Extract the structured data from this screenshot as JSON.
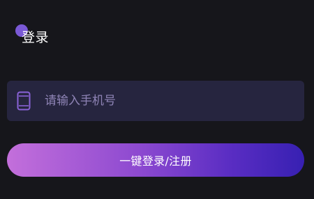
{
  "header": {
    "title": "登录"
  },
  "login_form": {
    "phone_placeholder": "请输入手机号",
    "phone_value": "",
    "submit_label": "一键登录/注册"
  },
  "icons": {
    "phone": "mobile-phone-icon"
  },
  "colors": {
    "background": "#16161b",
    "accent_purple": "#7a59d6",
    "input_background": "#26253f",
    "placeholder_text": "#8f84b6",
    "button_gradient_start": "#c36fdb",
    "button_gradient_end": "#3720b2",
    "title_text": "#ffffff"
  }
}
